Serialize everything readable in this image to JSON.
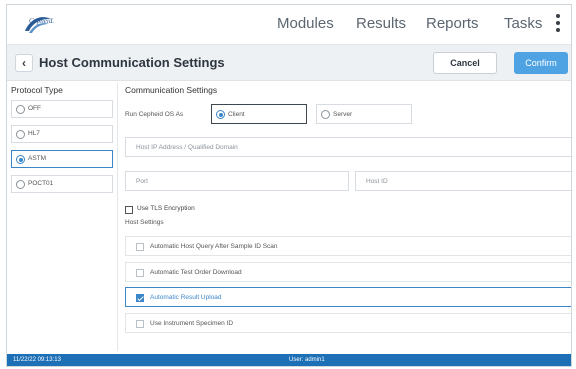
{
  "header": {
    "logo_text": "Cepheid.",
    "nav": {
      "modules": "Modules",
      "results": "Results",
      "reports": "Reports",
      "tasks": "Tasks"
    }
  },
  "titlebar": {
    "title": "Host Communication Settings",
    "cancel_label": "Cancel",
    "confirm_label": "Confirm"
  },
  "protocol": {
    "heading": "Protocol Type",
    "items": [
      {
        "label": "OFF",
        "selected": false
      },
      {
        "label": "HL7",
        "selected": false
      },
      {
        "label": "ASTM",
        "selected": true
      },
      {
        "label": "POCT01",
        "selected": false
      }
    ]
  },
  "comm": {
    "heading": "Communication Settings",
    "run_label": "Run Cepheid OS As",
    "client_label": "Client",
    "server_label": "Server",
    "selected_mode": "Client",
    "host_placeholder": "Host IP Address / Qualified Domain",
    "port_placeholder": "Port",
    "hostid_placeholder": "Host ID",
    "tls_label": "Use TLS Encryption",
    "tls_checked": false,
    "host_settings_heading": "Host Settings",
    "options": [
      {
        "label": "Automatic Host Query After Sample ID Scan",
        "checked": false
      },
      {
        "label": "Automatic Test Order Download",
        "checked": false
      },
      {
        "label": "Automatic Result Upload",
        "checked": true
      },
      {
        "label": "Use Instrument Specimen ID",
        "checked": false
      }
    ]
  },
  "status": {
    "datetime": "11/22/22 09:13:13",
    "user": "User: admin1"
  },
  "colors": {
    "accent": "#3b86c8",
    "confirm": "#4fa3e3",
    "statusbar": "#1d6fb6"
  }
}
